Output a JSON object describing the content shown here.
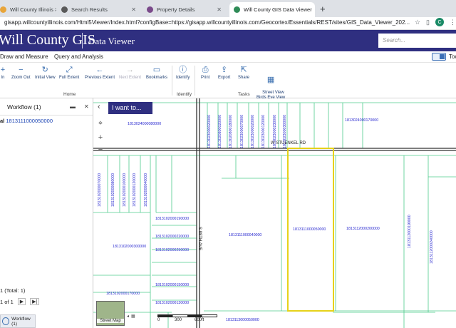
{
  "browser": {
    "tabs": [
      {
        "title": "Will County Illinois > County C",
        "active": false,
        "favicon_color": "#e8a53a"
      },
      {
        "title": "Search Results",
        "active": false,
        "favicon_color": "#5a5a5a"
      },
      {
        "title": "Property Details",
        "active": false,
        "favicon_color": "#7a4a8a"
      },
      {
        "title": "Will County GIS Data Viewer",
        "active": true,
        "favicon_color": "#2e8b57"
      }
    ],
    "new_tab": "+",
    "address": "gisapp.willcountyillinois.com/Html5Viewer/Index.html?configBase=https://gisapp.willcountyillinois.com/Geocortex/Essentials/REST/sites/GIS_Data_Viewer_202...",
    "profile_initial": "C"
  },
  "app": {
    "brand": "Will County GIS",
    "subtitle": "Data Viewer",
    "search_placeholder": "Search..."
  },
  "menu": {
    "items": [
      "Draw and Measure",
      "Query and Analysis"
    ],
    "toggle_label": "Too"
  },
  "ribbon": {
    "buttons": [
      {
        "label": "In",
        "icon": "zoom-in-icon",
        "glyph": "+"
      },
      {
        "label": "Zoom Out",
        "icon": "zoom-out-icon",
        "glyph": "−"
      },
      {
        "label": "Initial View",
        "icon": "refresh-icon",
        "glyph": "↻"
      },
      {
        "label": "Full Extent",
        "icon": "expand-icon",
        "glyph": "⤢"
      },
      {
        "label": "Previous Extent",
        "icon": "back-arrow-icon",
        "glyph": "←"
      },
      {
        "label": "Next Extent",
        "icon": "forward-arrow-icon",
        "glyph": "→"
      },
      {
        "label": "Bookmarks",
        "icon": "book-icon",
        "glyph": "▭"
      },
      {
        "label": "Identify",
        "icon": "info-icon",
        "glyph": "ⓘ"
      },
      {
        "label": "Print",
        "icon": "printer-icon",
        "glyph": "⎙"
      },
      {
        "label": "Export",
        "icon": "export-icon",
        "glyph": "⇪"
      },
      {
        "label": "Share",
        "icon": "share-icon",
        "glyph": "⇱"
      },
      {
        "label": "Street View\nBirds Eye View",
        "icon": "street-view-icon",
        "glyph": "▦"
      }
    ],
    "groups": [
      "Home",
      "Identify",
      "Tasks"
    ]
  },
  "workflow": {
    "title": "Workflow (1)",
    "item_prefix": "al",
    "item_link": "1813111000050000",
    "total": "1 (Total: 1)",
    "pager_text": "1 of 1",
    "tab_label": "Workflow (1)"
  },
  "map": {
    "iwant": "I want to...",
    "roads": [
      "W STUENKEL RD",
      "S 88TH AVE"
    ],
    "parcels": [
      "1813023000020000",
      "1813020800020000",
      "1813020800180000",
      "1813023000070000",
      "1813023000020000",
      "1813023000120000",
      "1813023000230000",
      "1813023000300000",
      "1813024000080000",
      "1813024000170000",
      "1813102000070000",
      "1813102000080000",
      "1813102000100000",
      "1813102000120000",
      "1813102000040000",
      "1813102000190000",
      "1813102000220000",
      "1813102000290000",
      "1813102000300000",
      "1813111000040000",
      "1813111000050000",
      "1813112000200000",
      "1813112000190000",
      "1813112000240000",
      "1813102000170000",
      "1813102000150000",
      "1813102000130000",
      "1813113000050000"
    ],
    "basemap_label": "Street Map",
    "scale_labels": [
      "0",
      "300",
      "600ft"
    ]
  }
}
